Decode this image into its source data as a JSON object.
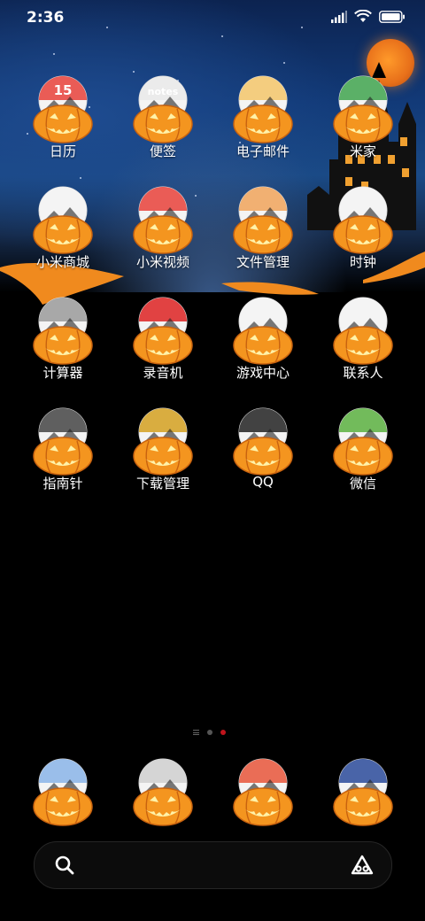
{
  "status_bar": {
    "time": "2:36",
    "icons": [
      "signal-icon",
      "wifi-icon",
      "battery-icon"
    ]
  },
  "apps": [
    {
      "label": "日历",
      "icon": "calendar-icon",
      "badge_text": "15",
      "accent": "#e8413a"
    },
    {
      "label": "便签",
      "icon": "notes-icon",
      "badge_text": "notes",
      "accent": "#e9e9e9"
    },
    {
      "label": "电子邮件",
      "icon": "email-icon",
      "accent": "#f3c56a"
    },
    {
      "label": "米家",
      "icon": "mijia-icon",
      "accent": "#3fa34d"
    },
    {
      "label": "小米商城",
      "icon": "mi-store-icon",
      "accent": "#f3f3f3"
    },
    {
      "label": "小米视频",
      "icon": "mi-video-icon",
      "accent": "#e8413a"
    },
    {
      "label": "文件管理",
      "icon": "file-manager-icon",
      "accent": "#f0a35a"
    },
    {
      "label": "时钟",
      "icon": "clock-icon",
      "accent": "#f3f3f3"
    },
    {
      "label": "计算器",
      "icon": "calculator-icon",
      "accent": "#9a9a9a"
    },
    {
      "label": "录音机",
      "icon": "recorder-icon",
      "accent": "#d22"
    },
    {
      "label": "游戏中心",
      "icon": "game-center-icon",
      "accent": "#f3f3f3"
    },
    {
      "label": "联系人",
      "icon": "contacts-icon",
      "accent": "#f3f3f3"
    },
    {
      "label": "指南针",
      "icon": "compass-icon",
      "accent": "#444"
    },
    {
      "label": "下载管理",
      "icon": "downloads-icon",
      "accent": "#d4a020"
    },
    {
      "label": "QQ",
      "icon": "qq-icon",
      "accent": "#222"
    },
    {
      "label": "微信",
      "icon": "wechat-icon",
      "accent": "#5bb040"
    }
  ],
  "dock": [
    {
      "icon": "phone-icon",
      "accent": "#8ab4e8"
    },
    {
      "icon": "messages-icon",
      "accent": "#cfcfcf"
    },
    {
      "icon": "browser-icon",
      "accent": "#e8553a"
    },
    {
      "icon": "camera-icon",
      "accent": "#2a4a9a"
    }
  ],
  "page_indicator": {
    "pages": 2,
    "active_page": 2
  },
  "colors": {
    "pumpkin": "#f4951f",
    "pumpkin_dark": "#c8620f",
    "active_dot": "#c0141c"
  },
  "search": {
    "search_icon": "search-icon",
    "assistant_icon": "assistant-icon"
  }
}
